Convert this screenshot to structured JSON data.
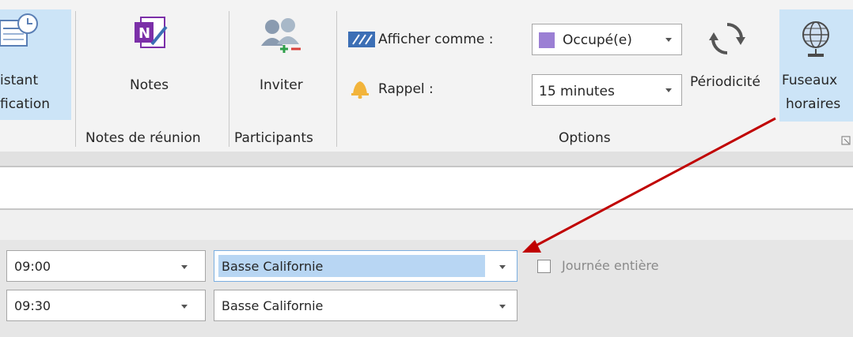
{
  "ribbon": {
    "assistant_line1": "istant",
    "assistant_line2": "fication",
    "notes_button": "Notes",
    "notes_group": "Notes de réunion",
    "invite_button": "Inviter",
    "participants_group": "Participants",
    "show_as_label": "Afficher comme :",
    "show_as_value": "Occupé(e)",
    "reminder_label": "Rappel :",
    "reminder_value": "15 minutes",
    "recurrence_button": "Périodicité",
    "timezones_line1": "Fuseaux",
    "timezones_line2": "horaires",
    "options_group": "Options",
    "colors": {
      "selected_highlight": "#cce4f7",
      "busy_color": "#9b7fd4",
      "onenote_purple": "#7b2fa8",
      "arrow_red": "#c00000"
    }
  },
  "form": {
    "start_time": "09:00",
    "start_timezone": "Basse Californie",
    "end_time": "09:30",
    "end_timezone": "Basse Californie",
    "all_day_label": "Journée entière",
    "all_day_checked": false
  }
}
